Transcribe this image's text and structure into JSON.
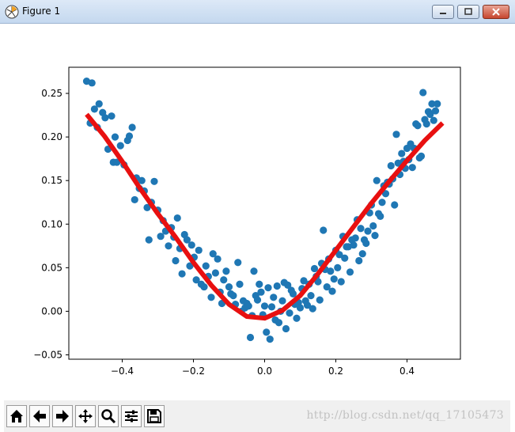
{
  "window": {
    "title": "Figure 1"
  },
  "toolbar": {
    "buttons": [
      "home-icon",
      "back-icon",
      "forward-icon",
      "pan-icon",
      "zoom-icon",
      "configure-icon",
      "save-icon"
    ]
  },
  "watermark": "http://blog.csdn.net/qq_17105473",
  "colors": {
    "scatter": "#1f77b4",
    "fit_line": "#e81010"
  },
  "chart_data": {
    "type": "scatter",
    "title": "",
    "xlabel": "",
    "ylabel": "",
    "xlim": [
      -0.55,
      0.55
    ],
    "ylim": [
      -0.055,
      0.28
    ],
    "x_ticks": [
      -0.4,
      -0.2,
      0.0,
      0.2,
      0.4
    ],
    "x_tick_labels": [
      "−0.4",
      "−0.2",
      "0.0",
      "0.2",
      "0.4"
    ],
    "y_ticks": [
      -0.05,
      0.0,
      0.05,
      0.1,
      0.15,
      0.2,
      0.25
    ],
    "y_tick_labels": [
      "−0.05",
      "0.00",
      "0.05",
      "0.10",
      "0.15",
      "0.20",
      "0.25"
    ],
    "grid": false,
    "series": [
      {
        "kind": "scatter",
        "points": [
          [
            -0.5,
            0.264
          ],
          [
            -0.49,
            0.216
          ],
          [
            -0.485,
            0.262
          ],
          [
            -0.478,
            0.232
          ],
          [
            -0.47,
            0.211
          ],
          [
            -0.465,
            0.238
          ],
          [
            -0.455,
            0.228
          ],
          [
            -0.448,
            0.222
          ],
          [
            -0.44,
            0.186
          ],
          [
            -0.43,
            0.224
          ],
          [
            -0.425,
            0.171
          ],
          [
            -0.42,
            0.2
          ],
          [
            -0.415,
            0.171
          ],
          [
            -0.405,
            0.19
          ],
          [
            -0.395,
            0.168
          ],
          [
            -0.385,
            0.196
          ],
          [
            -0.38,
            0.201
          ],
          [
            -0.372,
            0.211
          ],
          [
            -0.365,
            0.128
          ],
          [
            -0.36,
            0.153
          ],
          [
            -0.352,
            0.141
          ],
          [
            -0.345,
            0.15
          ],
          [
            -0.338,
            0.138
          ],
          [
            -0.33,
            0.119
          ],
          [
            -0.325,
            0.082
          ],
          [
            -0.318,
            0.125
          ],
          [
            -0.31,
            0.149
          ],
          [
            -0.3,
            0.116
          ],
          [
            -0.292,
            0.086
          ],
          [
            -0.285,
            0.104
          ],
          [
            -0.278,
            0.092
          ],
          [
            -0.27,
            0.075
          ],
          [
            -0.262,
            0.096
          ],
          [
            -0.255,
            0.085
          ],
          [
            -0.25,
            0.058
          ],
          [
            -0.245,
            0.107
          ],
          [
            -0.238,
            0.072
          ],
          [
            -0.232,
            0.043
          ],
          [
            -0.225,
            0.088
          ],
          [
            -0.218,
            0.082
          ],
          [
            -0.21,
            0.052
          ],
          [
            -0.205,
            0.076
          ],
          [
            -0.198,
            0.062
          ],
          [
            -0.192,
            0.036
          ],
          [
            -0.185,
            0.07
          ],
          [
            -0.178,
            0.031
          ],
          [
            -0.17,
            0.028
          ],
          [
            -0.165,
            0.052
          ],
          [
            -0.158,
            0.04
          ],
          [
            -0.15,
            0.016
          ],
          [
            -0.145,
            0.066
          ],
          [
            -0.138,
            0.044
          ],
          [
            -0.132,
            0.06
          ],
          [
            -0.125,
            0.022
          ],
          [
            -0.12,
            0.009
          ],
          [
            -0.115,
            0.036
          ],
          [
            -0.108,
            0.046
          ],
          [
            -0.1,
            0.028
          ],
          [
            -0.095,
            0.02
          ],
          [
            -0.088,
            0.018
          ],
          [
            -0.082,
            0.008
          ],
          [
            -0.075,
            0.056
          ],
          [
            -0.07,
            0.031
          ],
          [
            -0.065,
            0.0
          ],
          [
            -0.06,
            0.012
          ],
          [
            -0.055,
            0.004
          ],
          [
            -0.05,
            0.009
          ],
          [
            -0.045,
            0.006
          ],
          [
            -0.04,
            -0.03
          ],
          [
            -0.035,
            -0.005
          ],
          [
            -0.03,
            0.046
          ],
          [
            -0.025,
            0.018
          ],
          [
            -0.02,
            0.013
          ],
          [
            -0.015,
            0.031
          ],
          [
            -0.01,
            0.022
          ],
          [
            -0.005,
            -0.004
          ],
          [
            0.0,
            0.006
          ],
          [
            0.005,
            -0.024
          ],
          [
            0.01,
            0.027
          ],
          [
            0.015,
            -0.032
          ],
          [
            0.02,
            0.005
          ],
          [
            0.025,
            0.016
          ],
          [
            0.03,
            -0.01
          ],
          [
            0.035,
            0.029
          ],
          [
            0.04,
            -0.013
          ],
          [
            0.045,
            0.0
          ],
          [
            0.05,
            0.012
          ],
          [
            0.055,
            0.033
          ],
          [
            0.06,
            -0.02
          ],
          [
            0.065,
            0.03
          ],
          [
            0.07,
            -0.002
          ],
          [
            0.075,
            0.024
          ],
          [
            0.08,
            0.02
          ],
          [
            0.085,
            0.008
          ],
          [
            0.09,
            -0.008
          ],
          [
            0.095,
            0.01
          ],
          [
            0.1,
            0.004
          ],
          [
            0.105,
            0.026
          ],
          [
            0.11,
            0.035
          ],
          [
            0.115,
            0.012
          ],
          [
            0.12,
            0.007
          ],
          [
            0.125,
            0.031
          ],
          [
            0.13,
            0.018
          ],
          [
            0.135,
            0.003
          ],
          [
            0.14,
            0.049
          ],
          [
            0.145,
            0.04
          ],
          [
            0.15,
            0.034
          ],
          [
            0.155,
            0.013
          ],
          [
            0.16,
            0.055
          ],
          [
            0.165,
            0.093
          ],
          [
            0.17,
            0.048
          ],
          [
            0.175,
            0.028
          ],
          [
            0.18,
            0.06
          ],
          [
            0.185,
            0.046
          ],
          [
            0.19,
            0.023
          ],
          [
            0.195,
            0.037
          ],
          [
            0.2,
            0.07
          ],
          [
            0.205,
            0.05
          ],
          [
            0.21,
            0.065
          ],
          [
            0.215,
            0.034
          ],
          [
            0.22,
            0.086
          ],
          [
            0.225,
            0.061
          ],
          [
            0.23,
            0.074
          ],
          [
            0.235,
            0.074
          ],
          [
            0.24,
            0.045
          ],
          [
            0.245,
            0.082
          ],
          [
            0.25,
            0.076
          ],
          [
            0.255,
            0.084
          ],
          [
            0.26,
            0.105
          ],
          [
            0.265,
            0.058
          ],
          [
            0.27,
            0.095
          ],
          [
            0.275,
            0.066
          ],
          [
            0.28,
            0.082
          ],
          [
            0.285,
            0.078
          ],
          [
            0.29,
            0.092
          ],
          [
            0.295,
            0.113
          ],
          [
            0.3,
            0.122
          ],
          [
            0.305,
            0.098
          ],
          [
            0.31,
            0.087
          ],
          [
            0.315,
            0.15
          ],
          [
            0.32,
            0.112
          ],
          [
            0.325,
            0.109
          ],
          [
            0.33,
            0.125
          ],
          [
            0.335,
            0.144
          ],
          [
            0.34,
            0.135
          ],
          [
            0.345,
            0.148
          ],
          [
            0.35,
            0.146
          ],
          [
            0.355,
            0.167
          ],
          [
            0.36,
            0.152
          ],
          [
            0.365,
            0.122
          ],
          [
            0.37,
            0.203
          ],
          [
            0.375,
            0.17
          ],
          [
            0.38,
            0.157
          ],
          [
            0.385,
            0.181
          ],
          [
            0.39,
            0.172
          ],
          [
            0.395,
            0.164
          ],
          [
            0.4,
            0.187
          ],
          [
            0.405,
            0.174
          ],
          [
            0.41,
            0.192
          ],
          [
            0.415,
            0.165
          ],
          [
            0.42,
            0.187
          ],
          [
            0.425,
            0.215
          ],
          [
            0.43,
            0.213
          ],
          [
            0.435,
            0.176
          ],
          [
            0.44,
            0.178
          ],
          [
            0.445,
            0.251
          ],
          [
            0.45,
            0.22
          ],
          [
            0.455,
            0.215
          ],
          [
            0.46,
            0.229
          ],
          [
            0.465,
            0.226
          ],
          [
            0.47,
            0.238
          ],
          [
            0.475,
            0.219
          ],
          [
            0.48,
            0.23
          ],
          [
            0.485,
            0.238
          ]
        ]
      },
      {
        "kind": "line",
        "x": [
          -0.5,
          -0.45,
          -0.4,
          -0.35,
          -0.3,
          -0.25,
          -0.2,
          -0.15,
          -0.1,
          -0.05,
          0.0,
          0.05,
          0.1,
          0.15,
          0.2,
          0.25,
          0.3,
          0.35,
          0.4,
          0.45,
          0.5
        ],
        "y": [
          0.226,
          0.201,
          0.172,
          0.141,
          0.112,
          0.085,
          0.056,
          0.03,
          0.008,
          -0.006,
          -0.008,
          0.001,
          0.018,
          0.043,
          0.07,
          0.097,
          0.124,
          0.149,
          0.173,
          0.196,
          0.216
        ]
      }
    ]
  }
}
